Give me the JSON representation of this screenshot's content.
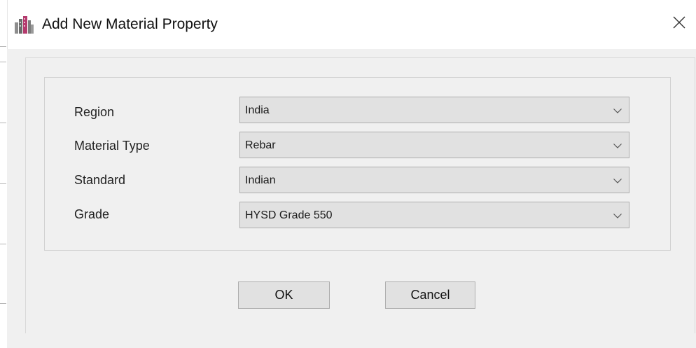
{
  "dialog": {
    "title": "Add New Material Property"
  },
  "fields": [
    {
      "label": "Region",
      "value": "India"
    },
    {
      "label": "Material Type",
      "value": "Rebar"
    },
    {
      "label": "Standard",
      "value": "Indian"
    },
    {
      "label": "Grade",
      "value": "HYSD Grade 550"
    }
  ],
  "buttons": {
    "ok": "OK",
    "cancel": "Cancel"
  },
  "icons": {
    "app": "app-logo-icon",
    "close": "close-icon",
    "dropdown": "chevron-down-icon"
  },
  "colors": {
    "client_background": "#f0f0f0",
    "control_face": "#e1e1e1",
    "control_border": "#adadad",
    "app_icon_accent": "#b43a6d"
  }
}
